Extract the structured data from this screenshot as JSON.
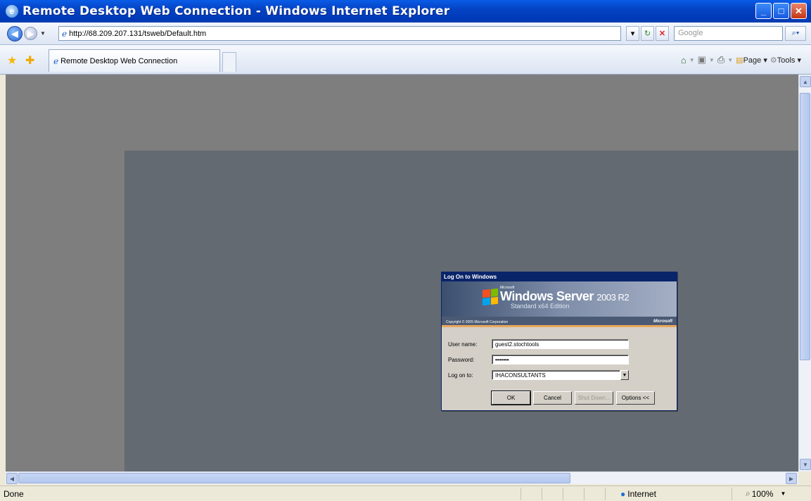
{
  "window": {
    "title": "Remote Desktop Web Connection - Windows Internet Explorer"
  },
  "address": {
    "url": "http://68.209.207.131/tsweb/Default.htm"
  },
  "search": {
    "placeholder": "Google"
  },
  "tab": {
    "label": "Remote Desktop Web Connection"
  },
  "commandbar": {
    "page_label": "Page",
    "tools_label": "Tools"
  },
  "dialog": {
    "title": "Log On to Windows",
    "brand_small": "Microsoft",
    "product": "Windows Server",
    "version": "2003 R2",
    "edition": "Standard x64 Edition",
    "copyright": "Copyright © 2005  Microsoft Corporation",
    "ms_logo": "Microsoft",
    "username_label": "User name:",
    "username_value": "guest2.stochtools",
    "password_label": "Password:",
    "password_value": "•••••••",
    "logon_label": "Log on to:",
    "logon_value": "IHACONSULTANTS",
    "ok_label": "OK",
    "cancel_label": "Cancel",
    "shutdown_label": "Shut Down...",
    "options_label": "Options <<"
  },
  "status": {
    "left_text": "Done",
    "zone": "Internet",
    "zoom": "100%"
  }
}
